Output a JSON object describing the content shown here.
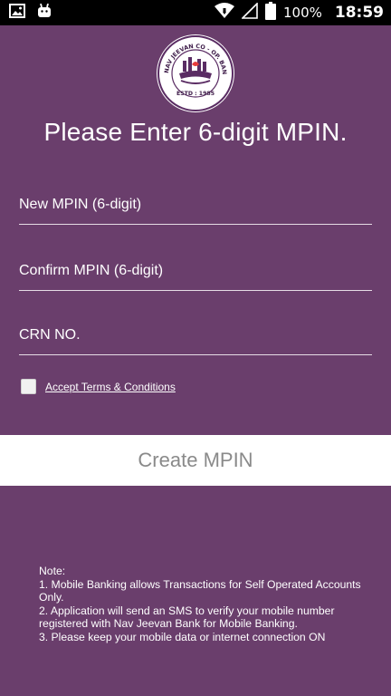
{
  "status_bar": {
    "battery_percent": "100%",
    "time": "18:59",
    "icons": [
      "image-icon",
      "android-icon",
      "wifi-icon",
      "signal-icon",
      "battery-icon"
    ]
  },
  "logo": {
    "top_text": "NAV JEEVAN CO - OP. BANK LTD.",
    "bottom_text": "ESTD : 1985"
  },
  "title": "Please Enter 6-digit MPIN.",
  "fields": {
    "new_mpin_placeholder": "New MPIN (6-digit)",
    "confirm_mpin_placeholder": "Confirm MPIN (6-digit)",
    "crn_placeholder": "CRN NO."
  },
  "terms": {
    "label": "Accept Terms & Conditions",
    "checked": false
  },
  "create_button": "Create MPIN",
  "note": {
    "heading": "Note:",
    "lines": [
      "1. Mobile Banking allows Transactions for Self Operated Accounts Only.",
      "2. Application will send an SMS to verify your mobile number registered with Nav Jeevan Bank for Mobile Banking.",
      "3. Please keep your mobile data or internet connection ON"
    ]
  },
  "colors": {
    "background": "#6a3e6c",
    "status_bar": "#000000",
    "button_bg": "#ffffff",
    "button_text": "#8a8a8a"
  }
}
